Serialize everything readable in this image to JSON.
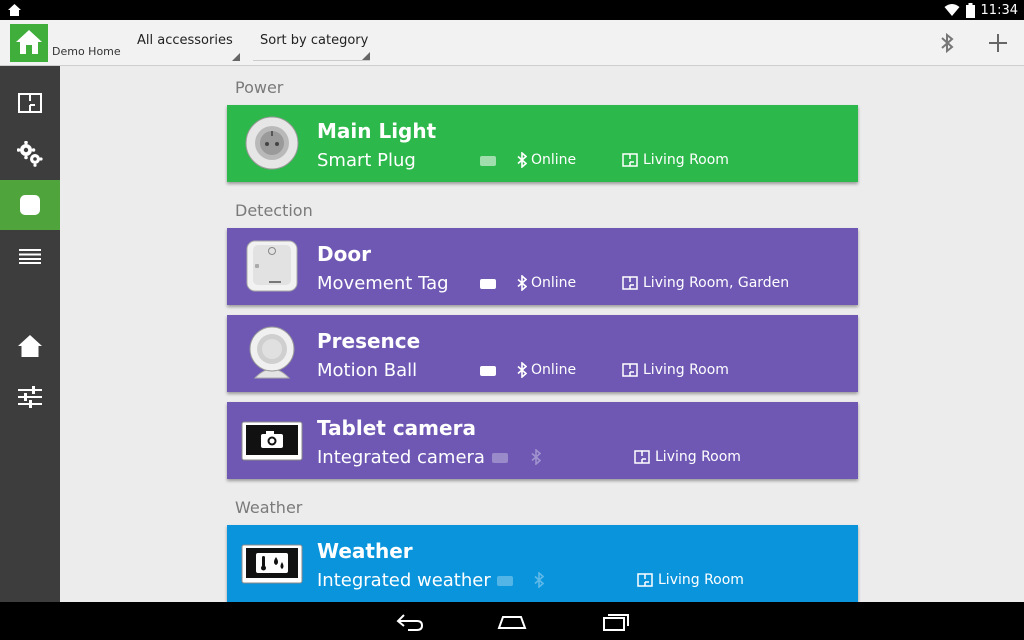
{
  "status_bar": {
    "time": "11:34"
  },
  "app": {
    "name": "Demo Home"
  },
  "filters": {
    "accessories": "All accessories",
    "sort": "Sort by category"
  },
  "sidebar": {
    "items": [
      {
        "icon": "floorplan-icon"
      },
      {
        "icon": "gears-icon"
      },
      {
        "icon": "device-icon"
      },
      {
        "icon": "list-icon"
      },
      {
        "icon": "home-icon"
      },
      {
        "icon": "sliders-icon"
      }
    ],
    "active_index": 2
  },
  "sections": [
    {
      "title": "Power",
      "cards": [
        {
          "name": "Main Light",
          "type": "Smart Plug",
          "status": "Online",
          "room": "Living Room",
          "color": "#2db84b"
        }
      ]
    },
    {
      "title": "Detection",
      "cards": [
        {
          "name": "Door",
          "type": "Movement Tag",
          "status": "Online",
          "room": "Living Room, Garden",
          "color": "#6e58b4"
        },
        {
          "name": "Presence",
          "type": "Motion Ball",
          "status": "Online",
          "room": "Living Room",
          "color": "#6e58b4"
        },
        {
          "name": "Tablet camera",
          "type": "Integrated camera",
          "status": "",
          "room": "Living Room",
          "color": "#6e58b4"
        }
      ]
    },
    {
      "title": "Weather",
      "cards": [
        {
          "name": "Weather",
          "type": "Integrated weather",
          "status": "",
          "room": "Living Room",
          "color": "#0a94dc"
        }
      ]
    }
  ]
}
